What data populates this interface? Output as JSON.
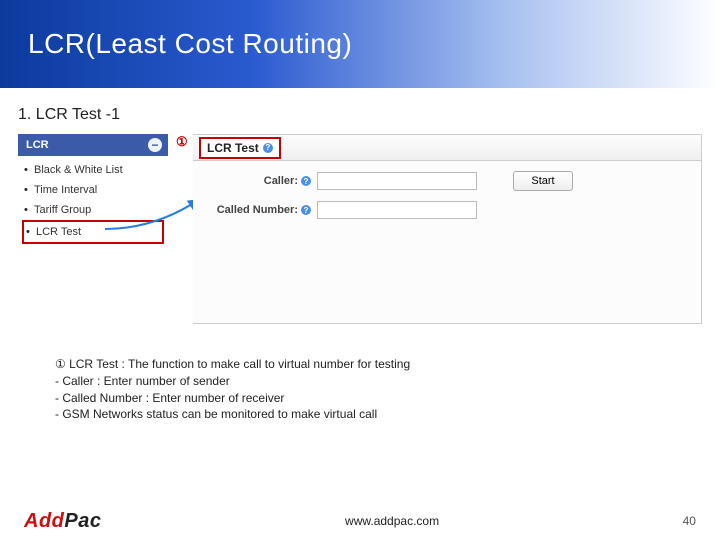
{
  "title": "LCR(Least Cost Routing)",
  "section": "1. LCR Test -1",
  "sidebar": {
    "header": "LCR",
    "items": [
      "Black & White List",
      "Time Interval",
      "Tariff Group",
      "LCR Test"
    ]
  },
  "callout": "①",
  "panel": {
    "title": "LCR Test",
    "caller_label": "Caller:",
    "called_label": "Called Number:",
    "start_label": "Start"
  },
  "desc": {
    "l1": "① LCR Test : The function to make call to virtual number for testing",
    "l2": "- Caller : Enter number of sender",
    "l3": "- Called Number : Enter number of receiver",
    "l4": "- GSM Networks status can be monitored to make virtual call"
  },
  "footer": {
    "brand_a": "Add",
    "brand_b": "Pac",
    "url": "www.addpac.com",
    "page": "40"
  }
}
